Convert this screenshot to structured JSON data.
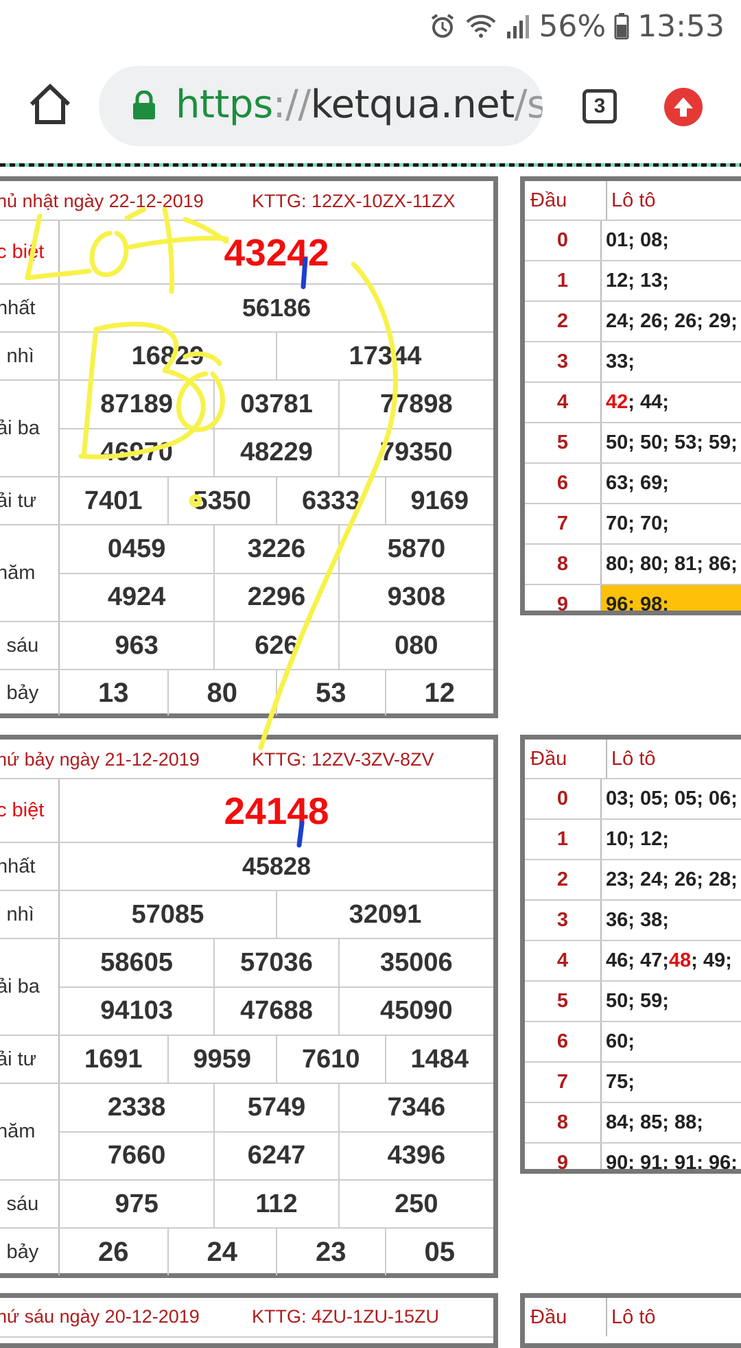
{
  "status_bar": {
    "battery": "56%",
    "time": "13:53"
  },
  "browser": {
    "url_scheme": "https",
    "url_sep": "://",
    "url_host": "ketqua.net",
    "url_path": "/so-",
    "tab_count": "3"
  },
  "draws": [
    {
      "date": "hủ nhật ngày 22-12-2019",
      "kttg": "KTTG: 12ZX-10ZX-11ZX",
      "prizes": [
        {
          "label": "c biệt",
          "rows": [
            [
              "43242"
            ]
          ]
        },
        {
          "label": " nhất",
          "rows": [
            [
              "56186"
            ]
          ]
        },
        {
          "label": "i nhì",
          "rows": [
            [
              "16829",
              "17344"
            ]
          ]
        },
        {
          "label": "ải ba",
          "rows": [
            [
              "87189",
              "03781",
              "77898"
            ],
            [
              "46970",
              "48229",
              "79350"
            ]
          ]
        },
        {
          "label": "ải tư",
          "rows": [
            [
              "7401",
              "5350",
              "6333",
              "9169"
            ]
          ]
        },
        {
          "label": " năm",
          "rows": [
            [
              "0459",
              "3226",
              "5870"
            ],
            [
              "4924",
              "2296",
              "9308"
            ]
          ]
        },
        {
          "label": "i sáu",
          "rows": [
            [
              "963",
              "626",
              "080"
            ]
          ]
        },
        {
          "label": "i bảy",
          "rows": [
            [
              "13",
              "80",
              "53",
              "12"
            ]
          ]
        }
      ],
      "loto": {
        "head_dau": "Đầu",
        "head_loto": "Lô tô",
        "rows": [
          {
            "dau": "0",
            "pre": "",
            "red": "",
            "post": "01; 08;"
          },
          {
            "dau": "1",
            "pre": "",
            "red": "",
            "post": "12; 13;"
          },
          {
            "dau": "2",
            "pre": "",
            "red": "",
            "post": "24; 26; 26; 29;"
          },
          {
            "dau": "3",
            "pre": "",
            "red": "",
            "post": "33;"
          },
          {
            "dau": "4",
            "pre": "",
            "red": "42",
            "post": "; 44;"
          },
          {
            "dau": "5",
            "pre": "",
            "red": "",
            "post": "50; 50; 53; 59;"
          },
          {
            "dau": "6",
            "pre": "",
            "red": "",
            "post": "63; 69;"
          },
          {
            "dau": "7",
            "pre": "",
            "red": "",
            "post": "70; 70;"
          },
          {
            "dau": "8",
            "pre": "",
            "red": "",
            "post": "80; 80; 81; 86;"
          },
          {
            "dau": "9",
            "pre": "",
            "red": "",
            "post": "96; 98;"
          }
        ]
      }
    },
    {
      "date": "hứ bảy ngày 21-12-2019",
      "kttg": "KTTG: 12ZV-3ZV-8ZV",
      "prizes": [
        {
          "label": "c biệt",
          "rows": [
            [
              "24148"
            ]
          ]
        },
        {
          "label": " nhất",
          "rows": [
            [
              "45828"
            ]
          ]
        },
        {
          "label": "i nhì",
          "rows": [
            [
              "57085",
              "32091"
            ]
          ]
        },
        {
          "label": "ải ba",
          "rows": [
            [
              "58605",
              "57036",
              "35006"
            ],
            [
              "94103",
              "47688",
              "45090"
            ]
          ]
        },
        {
          "label": "ải tư",
          "rows": [
            [
              "1691",
              "9959",
              "7610",
              "1484"
            ]
          ]
        },
        {
          "label": " năm",
          "rows": [
            [
              "2338",
              "5749",
              "7346"
            ],
            [
              "7660",
              "6247",
              "4396"
            ]
          ]
        },
        {
          "label": "i sáu",
          "rows": [
            [
              "975",
              "112",
              "250"
            ]
          ]
        },
        {
          "label": "i bảy",
          "rows": [
            [
              "26",
              "24",
              "23",
              "05"
            ]
          ]
        }
      ],
      "loto": {
        "head_dau": "Đầu",
        "head_loto": "Lô tô",
        "rows": [
          {
            "dau": "0",
            "pre": "",
            "red": "",
            "post": "03; 05; 05; 06;"
          },
          {
            "dau": "1",
            "pre": "",
            "red": "",
            "post": "10; 12;"
          },
          {
            "dau": "2",
            "pre": "",
            "red": "",
            "post": "23; 24; 26; 28;"
          },
          {
            "dau": "3",
            "pre": "",
            "red": "",
            "post": "36; 38;"
          },
          {
            "dau": "4",
            "pre": "46; 47; ",
            "red": "48",
            "post": "; 49;"
          },
          {
            "dau": "5",
            "pre": "",
            "red": "",
            "post": "50; 59;"
          },
          {
            "dau": "6",
            "pre": "",
            "red": "",
            "post": "60;"
          },
          {
            "dau": "7",
            "pre": "",
            "red": "",
            "post": "75;"
          },
          {
            "dau": "8",
            "pre": "",
            "red": "",
            "post": "84; 85; 88;"
          },
          {
            "dau": "9",
            "pre": "",
            "red": "",
            "post": "90; 91; 91; 96;"
          }
        ]
      }
    },
    {
      "date": "hứ sáu ngày 20-12-2019",
      "kttg": "KTTG: 4ZU-1ZU-15ZU",
      "loto_head_dau": "Đầu",
      "loto_head_loto": "Lô tô"
    }
  ],
  "annotation": {
    "text": "Lót Bò",
    "colors": {
      "ink": "#f7f24a",
      "pen": "#1b3fd1"
    }
  },
  "colors": {
    "special": "#f20d0d",
    "header_red": "#b01c1c",
    "highlight": "#ffc107"
  }
}
